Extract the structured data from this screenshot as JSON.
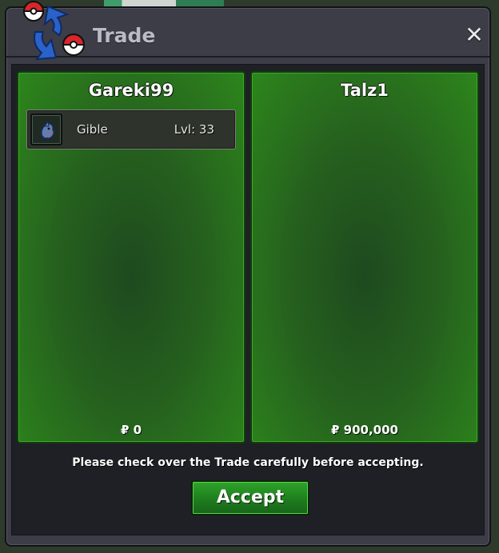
{
  "window": {
    "title": "Trade",
    "close_label": "✕"
  },
  "trade": {
    "left": {
      "player": "Gareki99",
      "money": "₽ 0",
      "items": [
        {
          "name": "Gible",
          "level": "Lvl: 33",
          "icon": "gible-icon"
        }
      ]
    },
    "right": {
      "player": "Talz1",
      "money": "₽ 900,000",
      "items": []
    }
  },
  "footer": {
    "notice": "Please check over the Trade carefully before accepting.",
    "accept_label": "Accept"
  },
  "colors": {
    "panel_green": "#2d861c",
    "accept_green": "#1f7d1d",
    "window_bg": "#3c3d46"
  }
}
